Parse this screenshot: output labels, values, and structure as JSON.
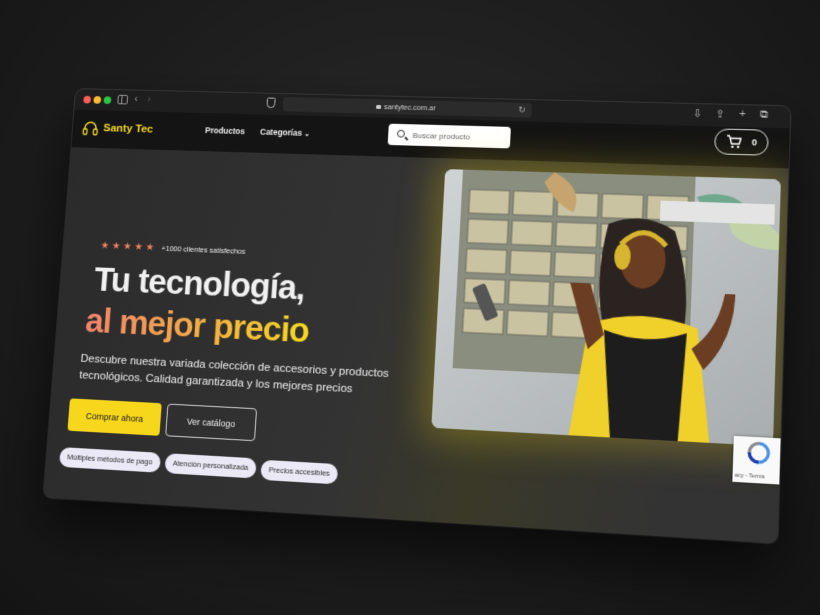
{
  "browser": {
    "url": "santytec.com.ar"
  },
  "header": {
    "brand": "Santy Tec",
    "menu": {
      "products": "Productos",
      "categories": "Categorías"
    },
    "search_placeholder": "Buscar producto",
    "cart_count": "0"
  },
  "hero": {
    "rating_stars": 5,
    "rating_text": "+1000 clientes satisfechos",
    "title_line1": "Tu tecnología,",
    "title_line2": "al mejor precio",
    "description": "Descubre nuestra variada colección de accesorios y productos tecnológicos. Calidad garantizada y los mejores precios",
    "primary_button": "Comprar ahora",
    "secondary_button": "Ver catálogo",
    "features": [
      "Múltiples métodos de pago",
      "Atención personalizada",
      "Precios accesibles"
    ]
  },
  "recaptcha": {
    "text": "acy - Terms"
  },
  "colors": {
    "brand_yellow": "#f7d71c",
    "gradient_start": "#f3836c",
    "star": "#f0825e",
    "header_bg": "#141414",
    "hero_bg": "#2f2f2f"
  }
}
